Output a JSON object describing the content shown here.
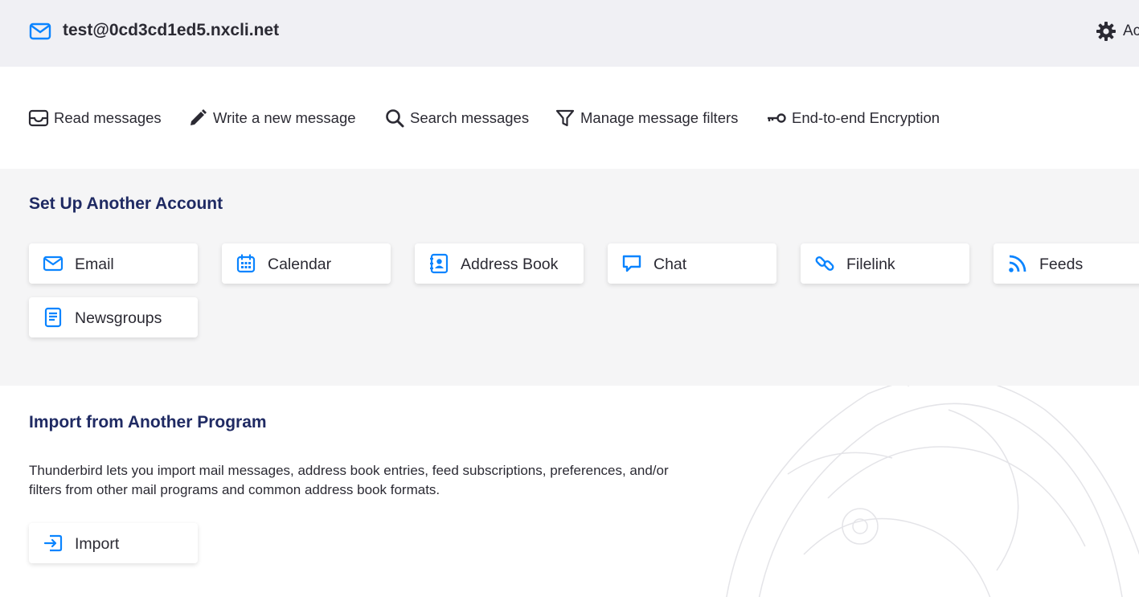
{
  "header": {
    "account_email": "test@0cd3cd1ed5.nxcli.net",
    "settings_label": "Ac",
    "icons": {
      "account": "mail-icon",
      "settings": "gear-icon"
    }
  },
  "actions": [
    {
      "label": "Read messages",
      "icon": "inbox-icon"
    },
    {
      "label": "Write a new message",
      "icon": "pencil-icon"
    },
    {
      "label": "Search messages",
      "icon": "search-icon"
    },
    {
      "label": "Manage message filters",
      "icon": "filter-icon"
    },
    {
      "label": "End-to-end Encryption",
      "icon": "key-icon"
    }
  ],
  "setup": {
    "title": "Set Up Another Account",
    "cards": [
      {
        "label": "Email",
        "icon": "mail-icon"
      },
      {
        "label": "Calendar",
        "icon": "calendar-icon"
      },
      {
        "label": "Address Book",
        "icon": "address-book-icon"
      },
      {
        "label": "Chat",
        "icon": "chat-icon"
      },
      {
        "label": "Filelink",
        "icon": "link-icon"
      },
      {
        "label": "Feeds",
        "icon": "rss-icon"
      },
      {
        "label": "Newsgroups",
        "icon": "newsgroup-icon"
      }
    ]
  },
  "import": {
    "title": "Import from Another Program",
    "description": "Thunderbird lets you import mail messages, address book entries, feed subscriptions, preferences, and/or filters from other mail programs and common address book formats.",
    "button_label": "Import",
    "icon": "import-icon"
  },
  "colors": {
    "accent": "#0060df",
    "title": "#1f2a63",
    "header_bg": "#f0f0f4",
    "section_bg": "#f5f5f6"
  }
}
